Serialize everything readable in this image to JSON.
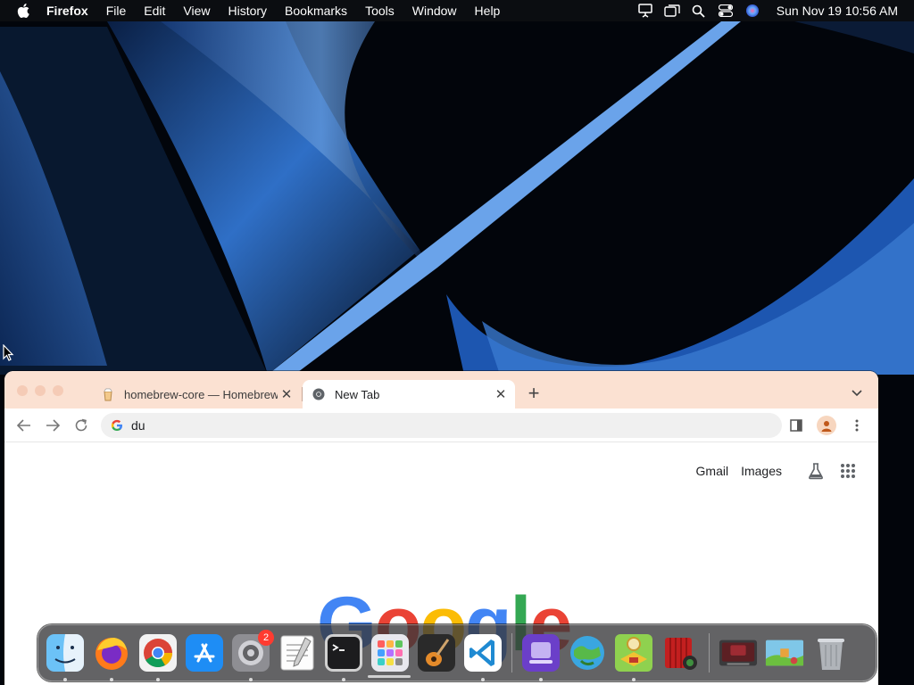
{
  "menubar": {
    "app_name": "Firefox",
    "menus": [
      "File",
      "Edit",
      "View",
      "History",
      "Bookmarks",
      "Tools",
      "Window",
      "Help"
    ],
    "clock": "Sun Nov 19  10:56 AM"
  },
  "browser": {
    "tabs": [
      {
        "title": "homebrew-core — Homebrew",
        "active": false
      },
      {
        "title": "New Tab",
        "active": true
      }
    ],
    "address_bar": {
      "value": "du"
    },
    "top_links": {
      "gmail": "Gmail",
      "images": "Images"
    },
    "logo_letters": [
      "G",
      "o",
      "o",
      "g",
      "l",
      "e"
    ]
  },
  "dock": {
    "items": [
      {
        "name": "finder-icon",
        "running": true
      },
      {
        "name": "firefox-icon",
        "running": true
      },
      {
        "name": "chrome-icon",
        "running": true
      },
      {
        "name": "app-store-icon",
        "running": false
      },
      {
        "name": "system-settings-icon",
        "running": true,
        "badge": "2"
      },
      {
        "name": "textedit-icon",
        "running": false
      },
      {
        "name": "terminal-icon",
        "running": true
      },
      {
        "name": "launchpad-icon",
        "running": false
      },
      {
        "name": "garageband-icon",
        "running": false
      },
      {
        "name": "vscode-icon",
        "running": true
      },
      {
        "name": "purple-app-icon",
        "running": true
      },
      {
        "name": "globe-game-icon",
        "running": false
      },
      {
        "name": "map-game-icon",
        "running": true
      },
      {
        "name": "red-app-icon",
        "running": false
      },
      {
        "name": "hand-mirror-icon",
        "running": false
      },
      {
        "name": "game-thumbnail-icon",
        "running": false
      },
      {
        "name": "trash-icon",
        "running": false
      }
    ]
  },
  "colors": {
    "tabstrip": "#fbe1d2",
    "google_blue": "#4285f4",
    "google_red": "#ea4335",
    "google_yellow": "#fbbc05",
    "google_green": "#34a853"
  }
}
